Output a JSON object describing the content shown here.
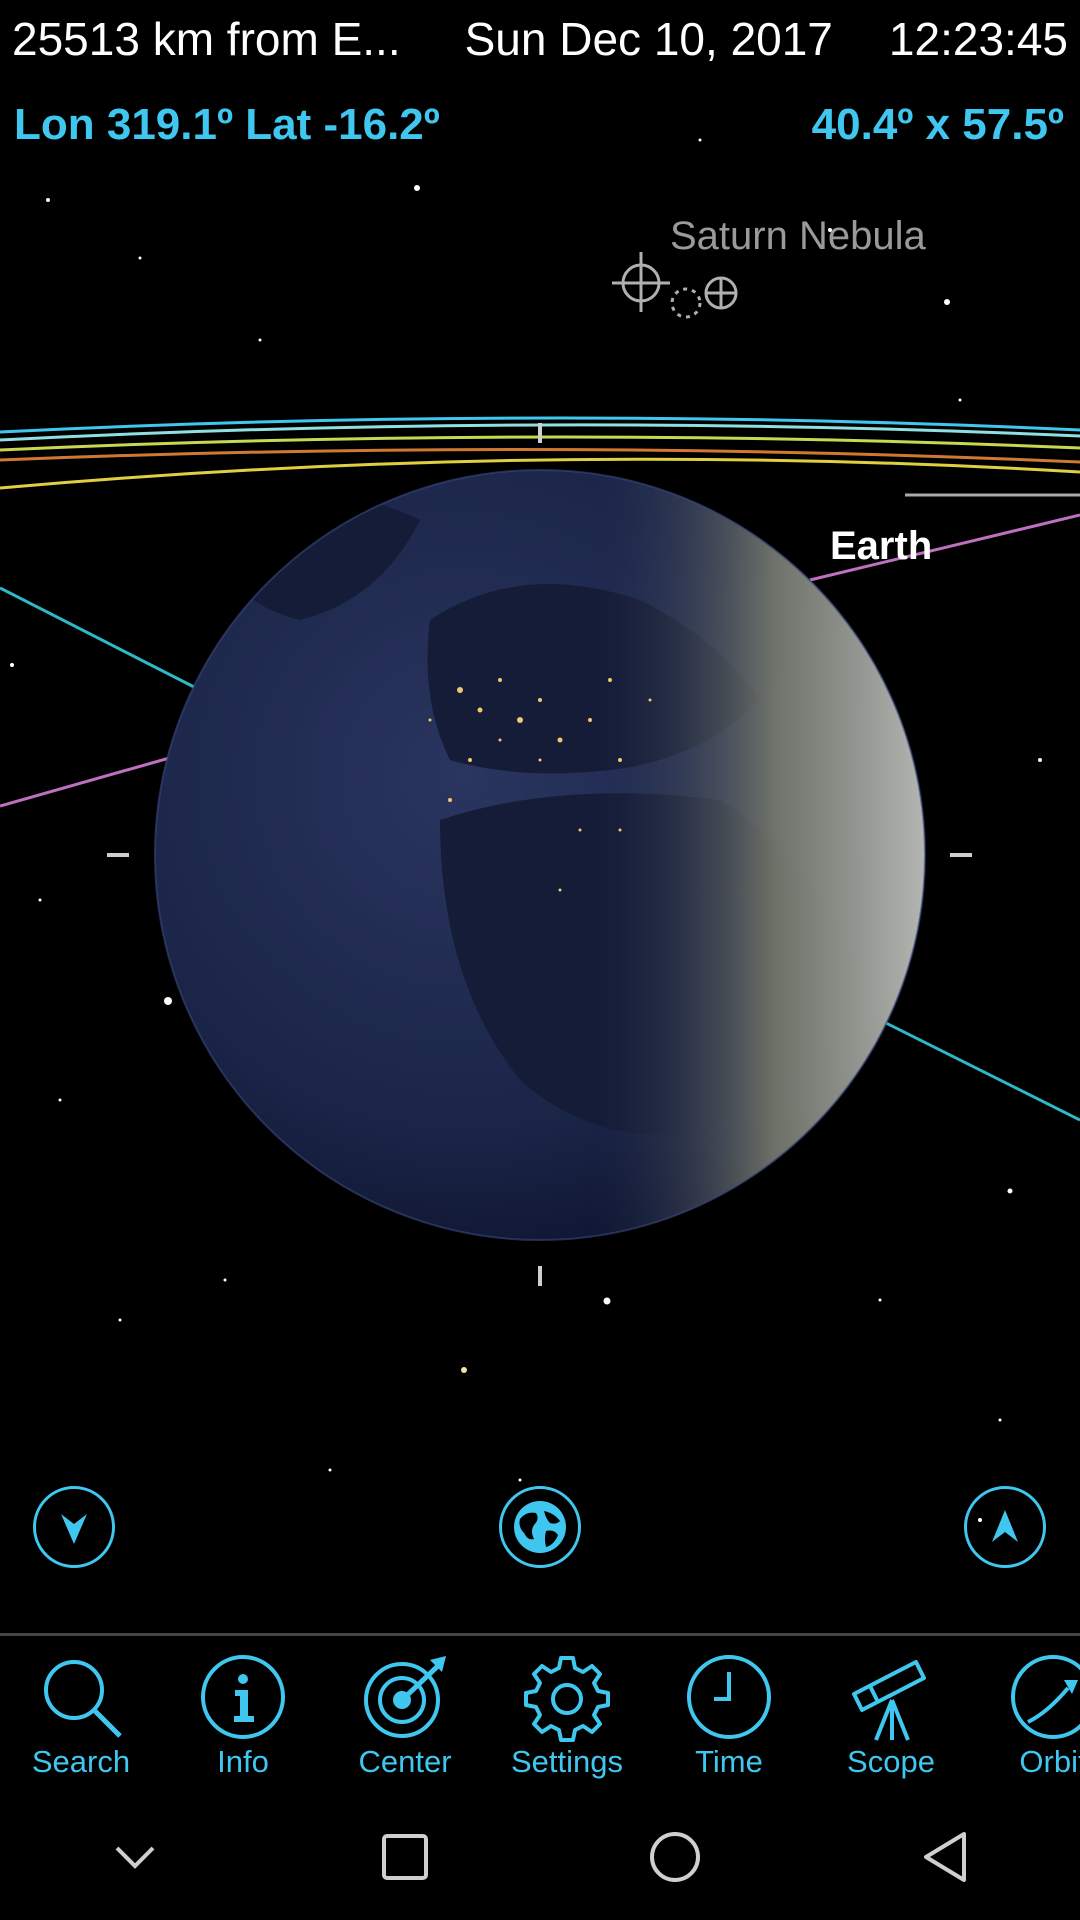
{
  "status": {
    "distance": "25513 km from E...",
    "date": "Sun Dec 10, 2017",
    "time": "12:23:45"
  },
  "view": {
    "coords": "Lon 319.1º Lat -16.2º",
    "fov": "40.4º x 57.5º"
  },
  "labels": {
    "nebula": "Saturn Nebula",
    "planet": "Earth"
  },
  "controls": {
    "down_icon": "chevron-down-icon",
    "globe_icon": "globe-icon",
    "up_icon": "chevron-up-icon"
  },
  "toolbar": {
    "items": [
      {
        "label": "Search",
        "icon": "search-icon"
      },
      {
        "label": "Info",
        "icon": "info-icon"
      },
      {
        "label": "Center",
        "icon": "target-icon"
      },
      {
        "label": "Settings",
        "icon": "gear-icon"
      },
      {
        "label": "Time",
        "icon": "clock-icon"
      },
      {
        "label": "Scope",
        "icon": "telescope-icon"
      },
      {
        "label": "Orbit",
        "icon": "orbit-icon"
      }
    ]
  },
  "colors": {
    "accent": "#3fc7ef",
    "background": "#000000",
    "ocean_night": "#1b2548",
    "land_day": "#8a8a78"
  }
}
